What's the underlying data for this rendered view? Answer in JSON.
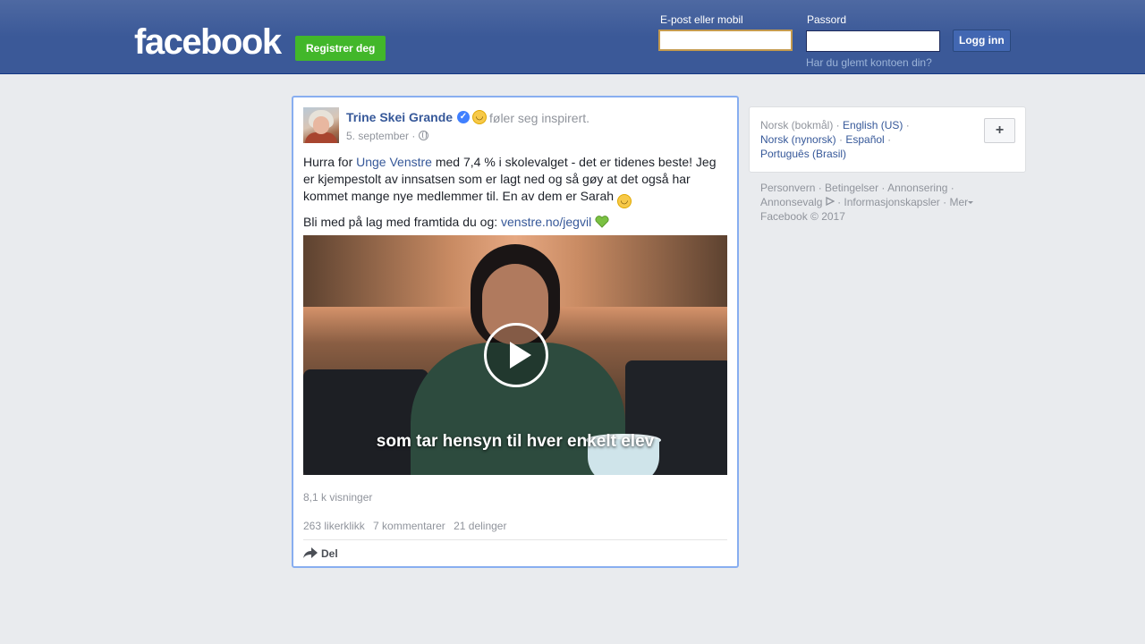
{
  "header": {
    "logo": "facebook",
    "register_label": "Registrer deg",
    "email_label": "E-post eller mobil",
    "email_value": "",
    "password_label": "Passord",
    "password_value": "",
    "login_label": "Logg inn",
    "forgot_label": "Har du glemt kontoen din?"
  },
  "post": {
    "author": "Trine Skei Grande",
    "feeling": "føler seg inspirert.",
    "timestamp": "5. september ·",
    "text_p1_a": "Hurra for ",
    "text_p1_link": "Unge Venstre",
    "text_p1_b": " med 7,4 % i skolevalget - det er tidenes beste! Jeg er kjempestolt av innsatsen som er lagt ned og så gøy at det også har kommet mange nye medlemmer til. En av dem er Sarah",
    "text_p2_a": "Bli med på lag med framtida du og: ",
    "text_p2_link": "venstre.no/jegvil",
    "video_subtitle": "som tar hensyn til hver enkelt elev",
    "views": "8,1 k visninger",
    "likes": "263 likerklikk",
    "comments": "7 kommentarer",
    "shares": "21 delinger",
    "share_label": "Del"
  },
  "sidebar": {
    "lang_current": "Norsk (bokmål) · ",
    "lang_1": "English (US)",
    "sep_1": " ·",
    "lang_2": "Norsk (nynorsk)",
    "sep_2": " · ",
    "lang_3": "Español",
    "sep_3": " ·",
    "lang_4": "Português (Brasil)",
    "lang_add": "+",
    "footer_line1": "Personvern · Betingelser · Annonsering ·",
    "footer_adchoices": "Annonsevalg",
    "footer_line2_rest": " · Informasjonskapsler · Mer",
    "footer_copyright": "Facebook © 2017"
  }
}
